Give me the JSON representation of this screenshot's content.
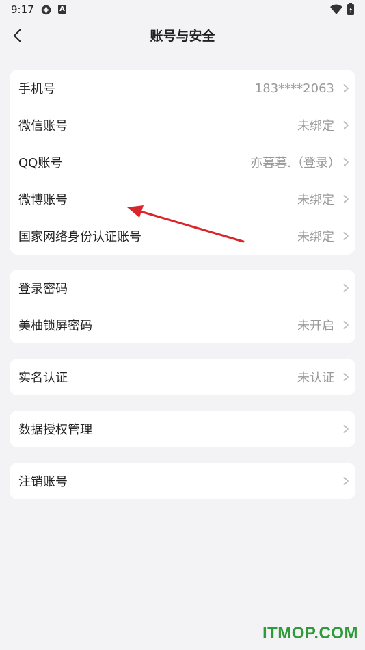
{
  "status": {
    "time": "9:17",
    "app_icon_letter": "A"
  },
  "header": {
    "title": "账号与安全"
  },
  "groups": [
    {
      "rows": [
        {
          "label": "手机号",
          "value": "183****2063"
        },
        {
          "label": "微信账号",
          "value": "未绑定"
        },
        {
          "label": "QQ账号",
          "value": "亦暮暮.（登录）"
        },
        {
          "label": "微博账号",
          "value": "未绑定"
        },
        {
          "label": "国家网络身份认证账号",
          "value": "未绑定"
        }
      ]
    },
    {
      "rows": [
        {
          "label": "登录密码",
          "value": ""
        },
        {
          "label": "美柚锁屏密码",
          "value": "未开启"
        }
      ]
    },
    {
      "rows": [
        {
          "label": "实名认证",
          "value": "未认证"
        }
      ]
    },
    {
      "rows": [
        {
          "label": "数据授权管理",
          "value": ""
        }
      ]
    },
    {
      "rows": [
        {
          "label": "注销账号",
          "value": ""
        }
      ]
    }
  ],
  "annotation": {
    "arrow_color": "#d9262b"
  },
  "watermark": {
    "text": "ITMOP.COM",
    "color": "#2e9a3a"
  }
}
